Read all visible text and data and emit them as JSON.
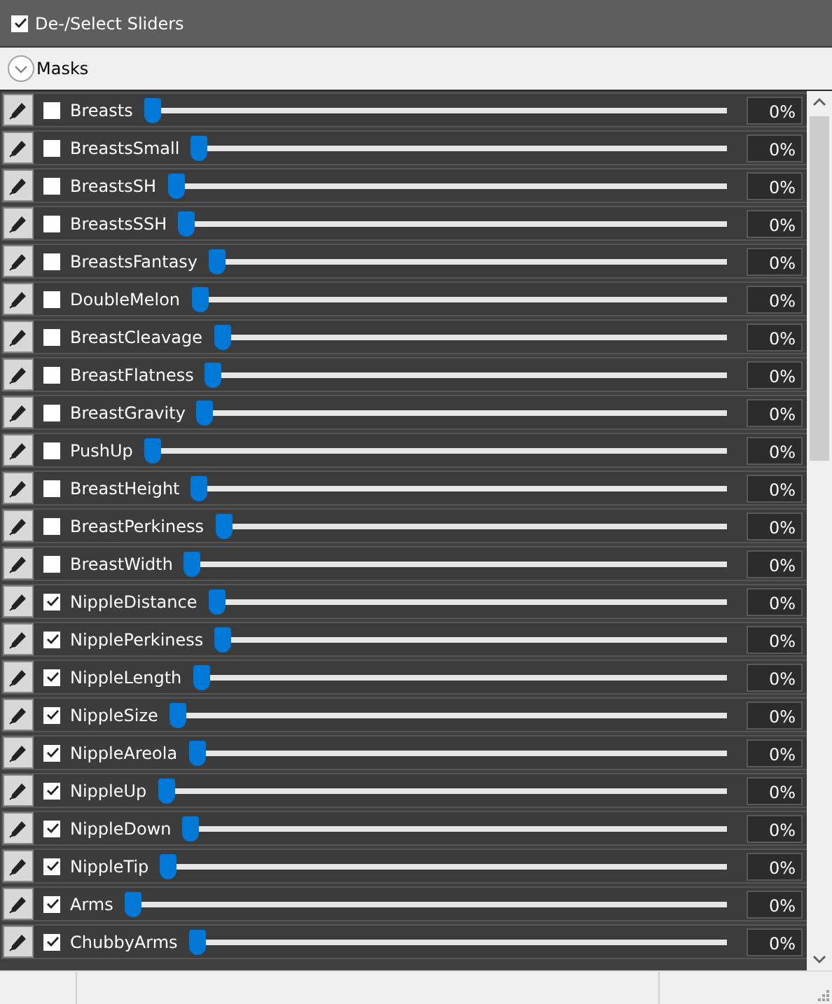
{
  "header": {
    "label": "De-/Select Sliders",
    "checked": true
  },
  "group": {
    "label": "Masks",
    "expanded": false
  },
  "sliders": [
    {
      "name": "Breasts",
      "checked": false,
      "level": 0,
      "reading": "0%"
    },
    {
      "name": "BreastsSmall",
      "checked": false,
      "level": 0,
      "reading": "0%"
    },
    {
      "name": "BreastsSH",
      "checked": false,
      "level": 0,
      "reading": "0%"
    },
    {
      "name": "BreastsSSH",
      "checked": false,
      "level": 0,
      "reading": "0%"
    },
    {
      "name": "BreastsFantasy",
      "checked": false,
      "level": 0,
      "reading": "0%"
    },
    {
      "name": "DoubleMelon",
      "checked": false,
      "level": 0,
      "reading": "0%"
    },
    {
      "name": "BreastCleavage",
      "checked": false,
      "level": 0,
      "reading": "0%"
    },
    {
      "name": "BreastFlatness",
      "checked": false,
      "level": 0,
      "reading": "0%"
    },
    {
      "name": "BreastGravity",
      "checked": false,
      "level": 0,
      "reading": "0%"
    },
    {
      "name": "PushUp",
      "checked": false,
      "level": 0,
      "reading": "0%"
    },
    {
      "name": "BreastHeight",
      "checked": false,
      "level": 0,
      "reading": "0%"
    },
    {
      "name": "BreastPerkiness",
      "checked": false,
      "level": 0,
      "reading": "0%"
    },
    {
      "name": "BreastWidth",
      "checked": false,
      "level": 0,
      "reading": "0%"
    },
    {
      "name": "NippleDistance",
      "checked": true,
      "level": 0,
      "reading": "0%"
    },
    {
      "name": "NipplePerkiness",
      "checked": true,
      "level": 0,
      "reading": "0%"
    },
    {
      "name": "NippleLength",
      "checked": true,
      "level": 0,
      "reading": "0%"
    },
    {
      "name": "NippleSize",
      "checked": true,
      "level": 0,
      "reading": "0%"
    },
    {
      "name": "NippleAreola",
      "checked": true,
      "level": 0,
      "reading": "0%"
    },
    {
      "name": "NippleUp",
      "checked": true,
      "level": 0,
      "reading": "0%"
    },
    {
      "name": "NippleDown",
      "checked": true,
      "level": 0,
      "reading": "0%"
    },
    {
      "name": "NippleTip",
      "checked": true,
      "level": 0,
      "reading": "0%"
    },
    {
      "name": "Arms",
      "checked": true,
      "level": 0,
      "reading": "0%"
    },
    {
      "name": "ChubbyArms",
      "checked": true,
      "level": 0,
      "reading": "0%"
    }
  ]
}
